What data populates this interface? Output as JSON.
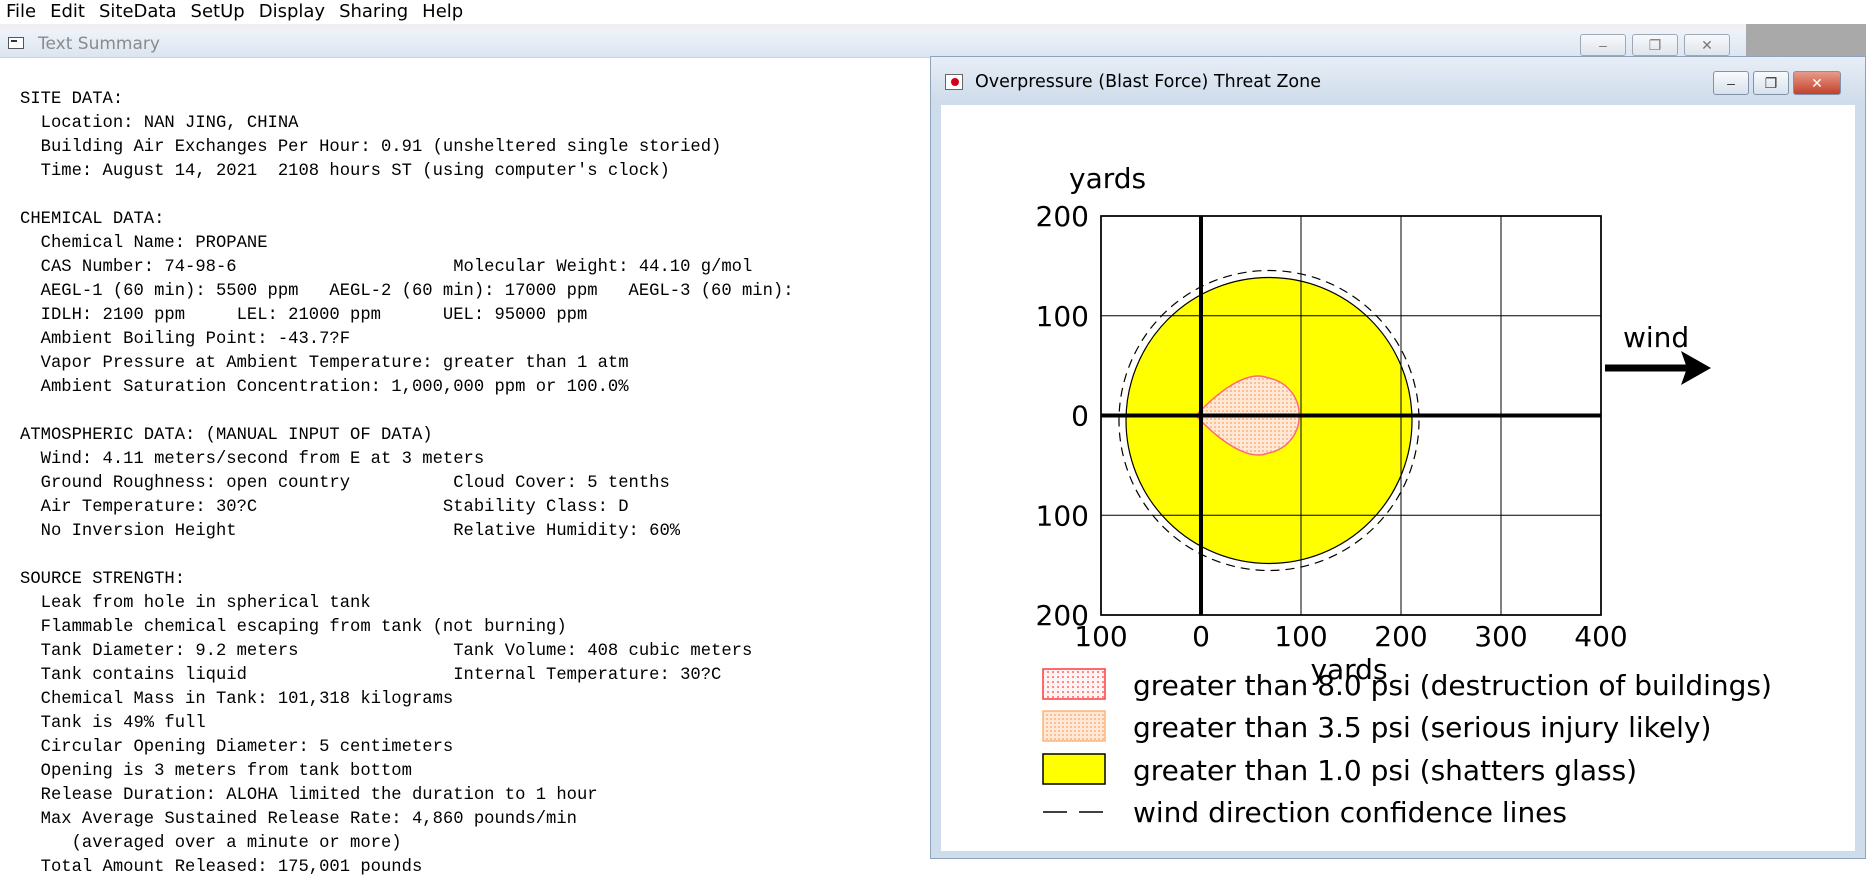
{
  "menubar": {
    "items": [
      "File",
      "Edit",
      "SiteData",
      "SetUp",
      "Display",
      "Sharing",
      "Help"
    ]
  },
  "summary_window": {
    "title": "Text Summary",
    "lines": [
      "SITE DATA:",
      "  Location: NAN JING, CHINA",
      "  Building Air Exchanges Per Hour: 0.91 (unsheltered single storied)",
      "  Time: August 14, 2021  2108 hours ST (using computer's clock)",
      "",
      "CHEMICAL DATA:",
      "  Chemical Name: PROPANE",
      "  CAS Number: 74-98-6                     Molecular Weight: 44.10 g/mol",
      "  AEGL-1 (60 min): 5500 ppm   AEGL-2 (60 min): 17000 ppm   AEGL-3 (60 min):",
      "  IDLH: 2100 ppm     LEL: 21000 ppm      UEL: 95000 ppm",
      "  Ambient Boiling Point: -43.7?F",
      "  Vapor Pressure at Ambient Temperature: greater than 1 atm",
      "  Ambient Saturation Concentration: 1,000,000 ppm or 100.0%",
      "",
      "ATMOSPHERIC DATA: (MANUAL INPUT OF DATA)",
      "  Wind: 4.11 meters/second from E at 3 meters",
      "  Ground Roughness: open country          Cloud Cover: 5 tenths",
      "  Air Temperature: 30?C                  Stability Class: D",
      "  No Inversion Height                     Relative Humidity: 60%",
      "",
      "SOURCE STRENGTH:",
      "  Leak from hole in spherical tank",
      "  Flammable chemical escaping from tank (not burning)",
      "  Tank Diameter: 9.2 meters               Tank Volume: 408 cubic meters",
      "  Tank contains liquid                    Internal Temperature: 30?C",
      "  Chemical Mass in Tank: 101,318 kilograms",
      "  Tank is 49% full",
      "  Circular Opening Diameter: 5 centimeters",
      "  Opening is 3 meters from tank bottom",
      "  Release Duration: ALOHA limited the duration to 1 hour",
      "  Max Average Sustained Release Rate: 4,860 pounds/min",
      "     (averaged over a minute or more)",
      "  Total Amount Released: 175,001 pounds"
    ]
  },
  "threat_window": {
    "title": "Overpressure (Blast Force) Threat Zone",
    "y_axis_title": "yards",
    "x_axis_title": "yards",
    "y_ticks": [
      "200",
      "100",
      "0",
      "100",
      "200"
    ],
    "x_ticks": [
      "100",
      "0",
      "100",
      "200",
      "300",
      "400"
    ],
    "wind_label": "wind",
    "legend": [
      {
        "label": "greater than 8.0 psi (destruction of buildings)",
        "swatch": "red-dotted",
        "color": "#ff3b3b"
      },
      {
        "label": "greater than 3.5 psi (serious injury likely)",
        "swatch": "orange-dotted",
        "color": "#ffb27a"
      },
      {
        "label": "greater than 1.0 psi (shatters glass)",
        "swatch": "yellow",
        "color": "#ffff00"
      },
      {
        "label": "wind direction confidence lines",
        "swatch": "dashed-line",
        "color": "#000000"
      }
    ]
  },
  "chart_data": {
    "type": "scatter",
    "title": "Overpressure (Blast Force) Threat Zone",
    "xlabel": "yards",
    "ylabel": "yards",
    "xlim": [
      -100,
      400
    ],
    "ylim": [
      -200,
      200
    ],
    "x_tick_labels": [
      "100",
      "0",
      "100",
      "200",
      "300",
      "400"
    ],
    "y_tick_labels": [
      "200",
      "100",
      "0",
      "100",
      "200"
    ],
    "grid": true,
    "zones": [
      {
        "name": "greater than 1.0 psi (shatters glass)",
        "color": "#ffff00",
        "center_x": 68,
        "center_y": -5,
        "radius": 143
      },
      {
        "name": "greater than 3.5 psi (serious injury likely)",
        "color": "#ffb27a",
        "x_extent": [
          -5,
          107
        ],
        "y_extent": [
          -40,
          40
        ]
      }
    ],
    "wind_direction_confidence_lines": true,
    "annotations": [
      "wind"
    ]
  }
}
